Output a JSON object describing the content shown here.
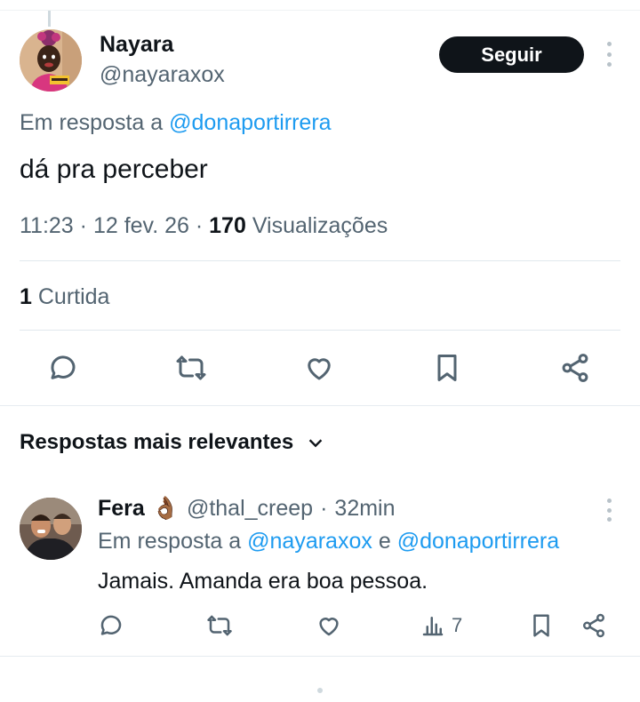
{
  "tweet": {
    "author_name": "Nayara",
    "author_handle": "@nayaraxox",
    "follow_label": "Seguir",
    "reply_prefix": "Em resposta a",
    "reply_mention": "@donaportirrera",
    "text": "dá pra perceber",
    "time": "11:23",
    "date": "12 fev. 26",
    "views_count": "170",
    "views_label": "Visualizações",
    "likes_count": "1",
    "likes_label": "Curtida"
  },
  "replies_section": {
    "title": "Respostas mais relevantes"
  },
  "reply": {
    "author_name": "Fera",
    "emoji": "👌🏾",
    "author_handle": "@thal_creep",
    "time_ago": "32min",
    "reply_prefix": "Em resposta a",
    "mention_1": "@nayaraxox",
    "conjunction": "e",
    "mention_2": "@donaportirrera",
    "text": "Jamais. Amanda era boa pessoa.",
    "views_count": "7"
  },
  "icons": [
    "reply-icon",
    "retweet-icon",
    "like-icon",
    "bookmark-icon",
    "share-icon",
    "views-icon",
    "chevron-down-icon",
    "more-icon"
  ],
  "colors": {
    "accent": "#1d9bf0",
    "text_primary": "#0f1419",
    "text_secondary": "#536471",
    "button_bg": "#0f1419"
  }
}
